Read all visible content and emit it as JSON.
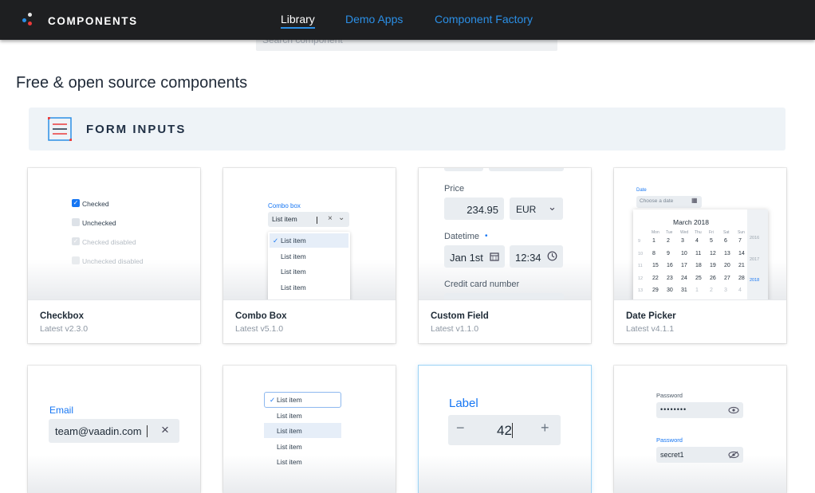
{
  "header": {
    "brand": "COMPONENTS",
    "nav": [
      "Library",
      "Demo Apps",
      "Component Factory"
    ],
    "search_placeholder": "Search component"
  },
  "page_title": "Free & open source components",
  "section": {
    "title": "FORM INPUTS"
  },
  "cards": [
    {
      "name": "Checkbox",
      "version": "Latest v2.3.0"
    },
    {
      "name": "Combo Box",
      "version": "Latest v5.1.0"
    },
    {
      "name": "Custom Field",
      "version": "Latest v1.1.0"
    },
    {
      "name": "Date Picker",
      "version": "Latest v4.1.1"
    }
  ],
  "previews": {
    "checkbox": {
      "items": [
        "Checked",
        "Unchecked",
        "Checked disabled",
        "Unchecked disabled"
      ]
    },
    "combo": {
      "label": "Combo box",
      "value": "List item",
      "options": [
        "List item",
        "List item",
        "List item",
        "List item"
      ]
    },
    "custom_field": {
      "price_label": "Price",
      "price_value": "234.95",
      "currency": "EUR",
      "datetime_label": "Datetime",
      "required_mark": "•",
      "date_value": "Jan 1st",
      "time_value": "12:34",
      "card_label": "Credit card number"
    },
    "date_picker": {
      "label": "Date",
      "placeholder": "Choose a date",
      "month": "March 2018",
      "weekdays": [
        "Mon",
        "Tue",
        "Wed",
        "Thu",
        "Fri",
        "Sat",
        "Sun"
      ],
      "weeks": [
        {
          "wk": "9",
          "days": [
            "1",
            "2",
            "3",
            "4",
            "5",
            "6",
            "7"
          ]
        },
        {
          "wk": "10",
          "days": [
            "8",
            "9",
            "10",
            "11",
            "12",
            "13",
            "14"
          ]
        },
        {
          "wk": "11",
          "days": [
            "15",
            "16",
            "17",
            "18",
            "19",
            "20",
            "21"
          ]
        },
        {
          "wk": "12",
          "days": [
            "22",
            "23",
            "24",
            "25",
            "26",
            "27",
            "28"
          ]
        },
        {
          "wk": "13",
          "days": [
            "29",
            "30",
            "31",
            "1",
            "2",
            "3",
            "4"
          ]
        }
      ],
      "years": [
        "2016",
        "2017",
        "2018"
      ]
    },
    "email": {
      "label": "Email",
      "value": "team@vaadin.com"
    },
    "list_box": {
      "items": [
        "List item",
        "List item",
        "List item",
        "List item",
        "List item"
      ]
    },
    "number_field": {
      "label": "Label",
      "value": "42",
      "minus": "−",
      "plus": "+"
    },
    "password": {
      "label1": "Password",
      "value1": "••••••••",
      "label2": "Password",
      "value2": "secret1"
    }
  },
  "colors": {
    "accent": "#1676f3",
    "topbar": "#1e1f21",
    "nav_link": "#2b8fe6",
    "section_bg": "#eef3f7"
  },
  "icons": {
    "logo": "dots-logo-icon",
    "section": "form-inputs-icon"
  }
}
